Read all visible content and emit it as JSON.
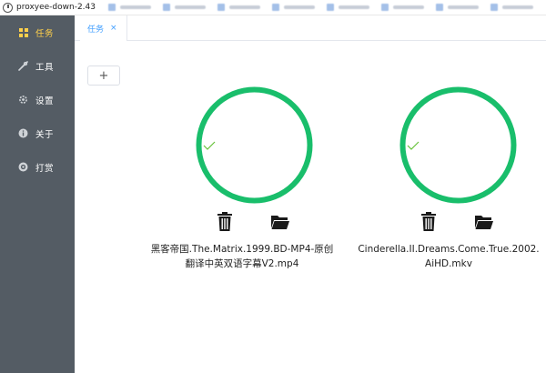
{
  "window": {
    "title": "proxyee-down-2.43"
  },
  "sidebar": {
    "items": [
      {
        "label": "任务",
        "icon": "grid-icon",
        "active": true
      },
      {
        "label": "工具",
        "icon": "tools-icon",
        "active": false
      },
      {
        "label": "设置",
        "icon": "gear-icon",
        "active": false
      },
      {
        "label": "关于",
        "icon": "info-icon",
        "active": false
      },
      {
        "label": "打赏",
        "icon": "donate-icon",
        "active": false
      }
    ]
  },
  "tabs": {
    "active_label": "任务",
    "close_glyph": "×"
  },
  "toolbar": {
    "add_label": "+"
  },
  "tasks": [
    {
      "name_line1": "黑客帝国.The.Matrix.1999.BD-MP4-原创",
      "name_line2": "翻译中英双语字幕V2.mp4",
      "status": "complete",
      "progress": 100
    },
    {
      "name_line1": "Cinderella.II.Dreams.Come.True.2002.",
      "name_line2": "AiHD.mkv",
      "status": "complete",
      "progress": 100
    }
  ],
  "colors": {
    "sidebar_bg": "#545c64",
    "sidebar_active": "#ffd04b",
    "accent": "#409eff",
    "success": "#19be6b",
    "check": "#67c23a"
  }
}
